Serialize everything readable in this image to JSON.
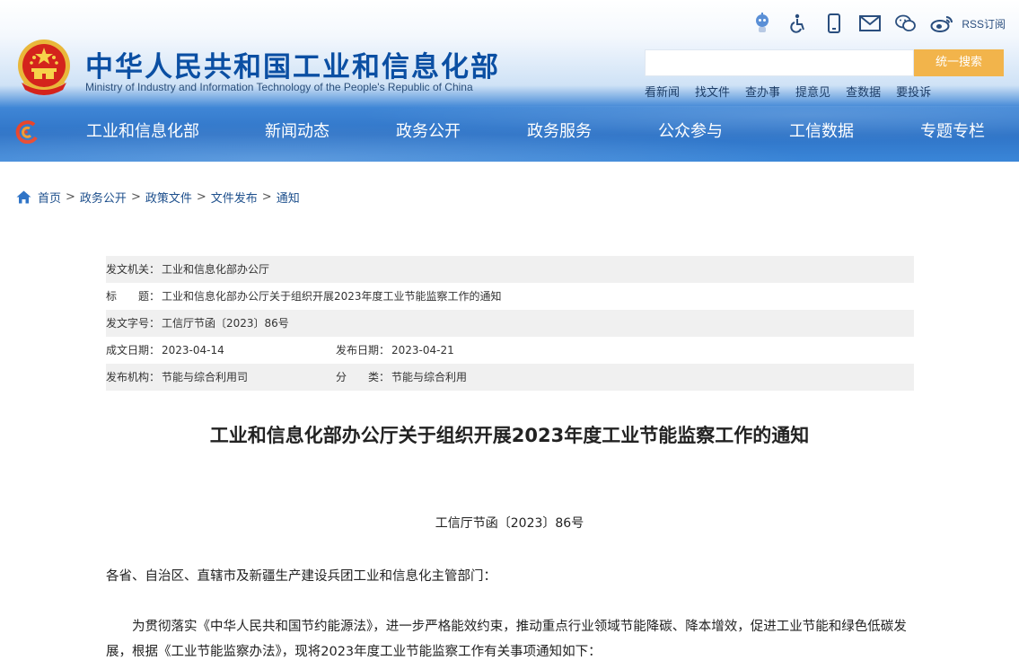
{
  "header": {
    "site_title": "中华人民共和国工业和信息化部",
    "site_subtitle": "Ministry of Industry and Information Technology of the People's Republic of China",
    "top_icons": [
      "robot-assistant-icon",
      "accessibility-icon",
      "mobile-icon",
      "mail-icon",
      "wechat-icon",
      "weibo-icon"
    ],
    "rss_label": "RSS订阅",
    "search_placeholder": "",
    "search_button": "统一搜索",
    "quick_links": [
      "看新闻",
      "找文件",
      "查办事",
      "提意见",
      "查数据",
      "要投诉"
    ],
    "nav": [
      "工业和信息化部",
      "新闻动态",
      "政务公开",
      "政务服务",
      "公众参与",
      "工信数据",
      "专题专栏"
    ]
  },
  "breadcrumb": [
    "首页",
    "政务公开",
    "政策文件",
    "文件发布",
    "通知"
  ],
  "meta": {
    "issuer_label": "发文机关：",
    "issuer": "工业和信息化部办公厅",
    "title_label": "标　　题：",
    "title": "工业和信息化部办公厅关于组织开展2023年度工业节能监察工作的通知",
    "doc_no_label": "发文字号：",
    "doc_no": "工信厅节函〔2023〕86号",
    "created_label": "成文日期：",
    "created": "2023-04-14",
    "published_label": "发布日期：",
    "published": "2023-04-21",
    "org_label": "发布机构：",
    "org": "节能与综合利用司",
    "category_label": "分　　类：",
    "category": "节能与综合利用"
  },
  "article": {
    "title": "工业和信息化部办公厅关于组织开展2023年度工业节能监察工作的通知",
    "doc_number": "工信厅节函〔2023〕86号",
    "salutation": "各省、自治区、直辖市及新疆生产建设兵团工业和信息化主管部门：",
    "paragraph1": "为贯彻落实《中华人民共和国节约能源法》，进一步严格能效约束，推动重点行业领域节能降碳、降本增效，促进工业节能和绿色低碳发展，根据《工业节能监察办法》，现将2023年度工业节能监察工作有关事项通知如下："
  },
  "colors": {
    "title_blue": "#0b4fa3",
    "nav_blue": "#2f74c7",
    "search_button": "#f2b44b",
    "meta_shade": "#f0f0f0"
  }
}
